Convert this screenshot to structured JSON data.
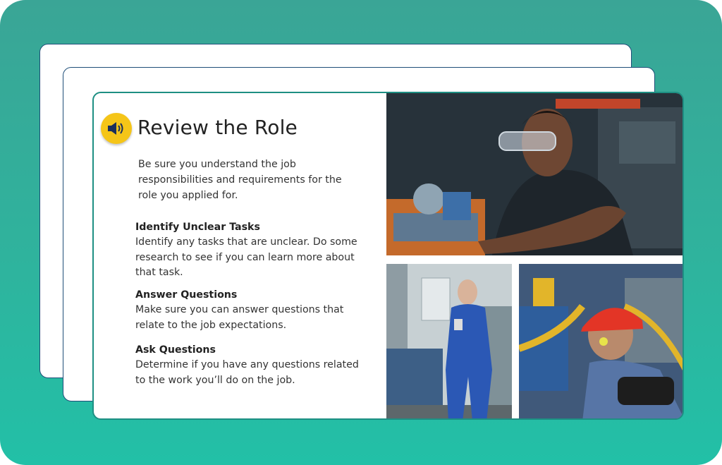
{
  "lesson": {
    "title": "Review the Role",
    "intro": "Be sure you understand the job responsibilities and requirements for the role you applied for.",
    "audio_icon": "speaker-icon",
    "sections": [
      {
        "heading": "Identify Unclear Tasks",
        "body": "Identify any tasks that are unclear. Do some research to see if you can learn more about that task."
      },
      {
        "heading": "Answer Questions",
        "body": "Make sure you can answer questions that relate to the job expectations."
      },
      {
        "heading": "Ask Questions",
        "body": "Determine if you have any questions related to the work you’ll do on the job."
      }
    ]
  },
  "colors": {
    "background": "#2fb39d",
    "card_border": "#1e8f83",
    "badge": "#f5c518",
    "back_card_border": "#1f4e78"
  }
}
